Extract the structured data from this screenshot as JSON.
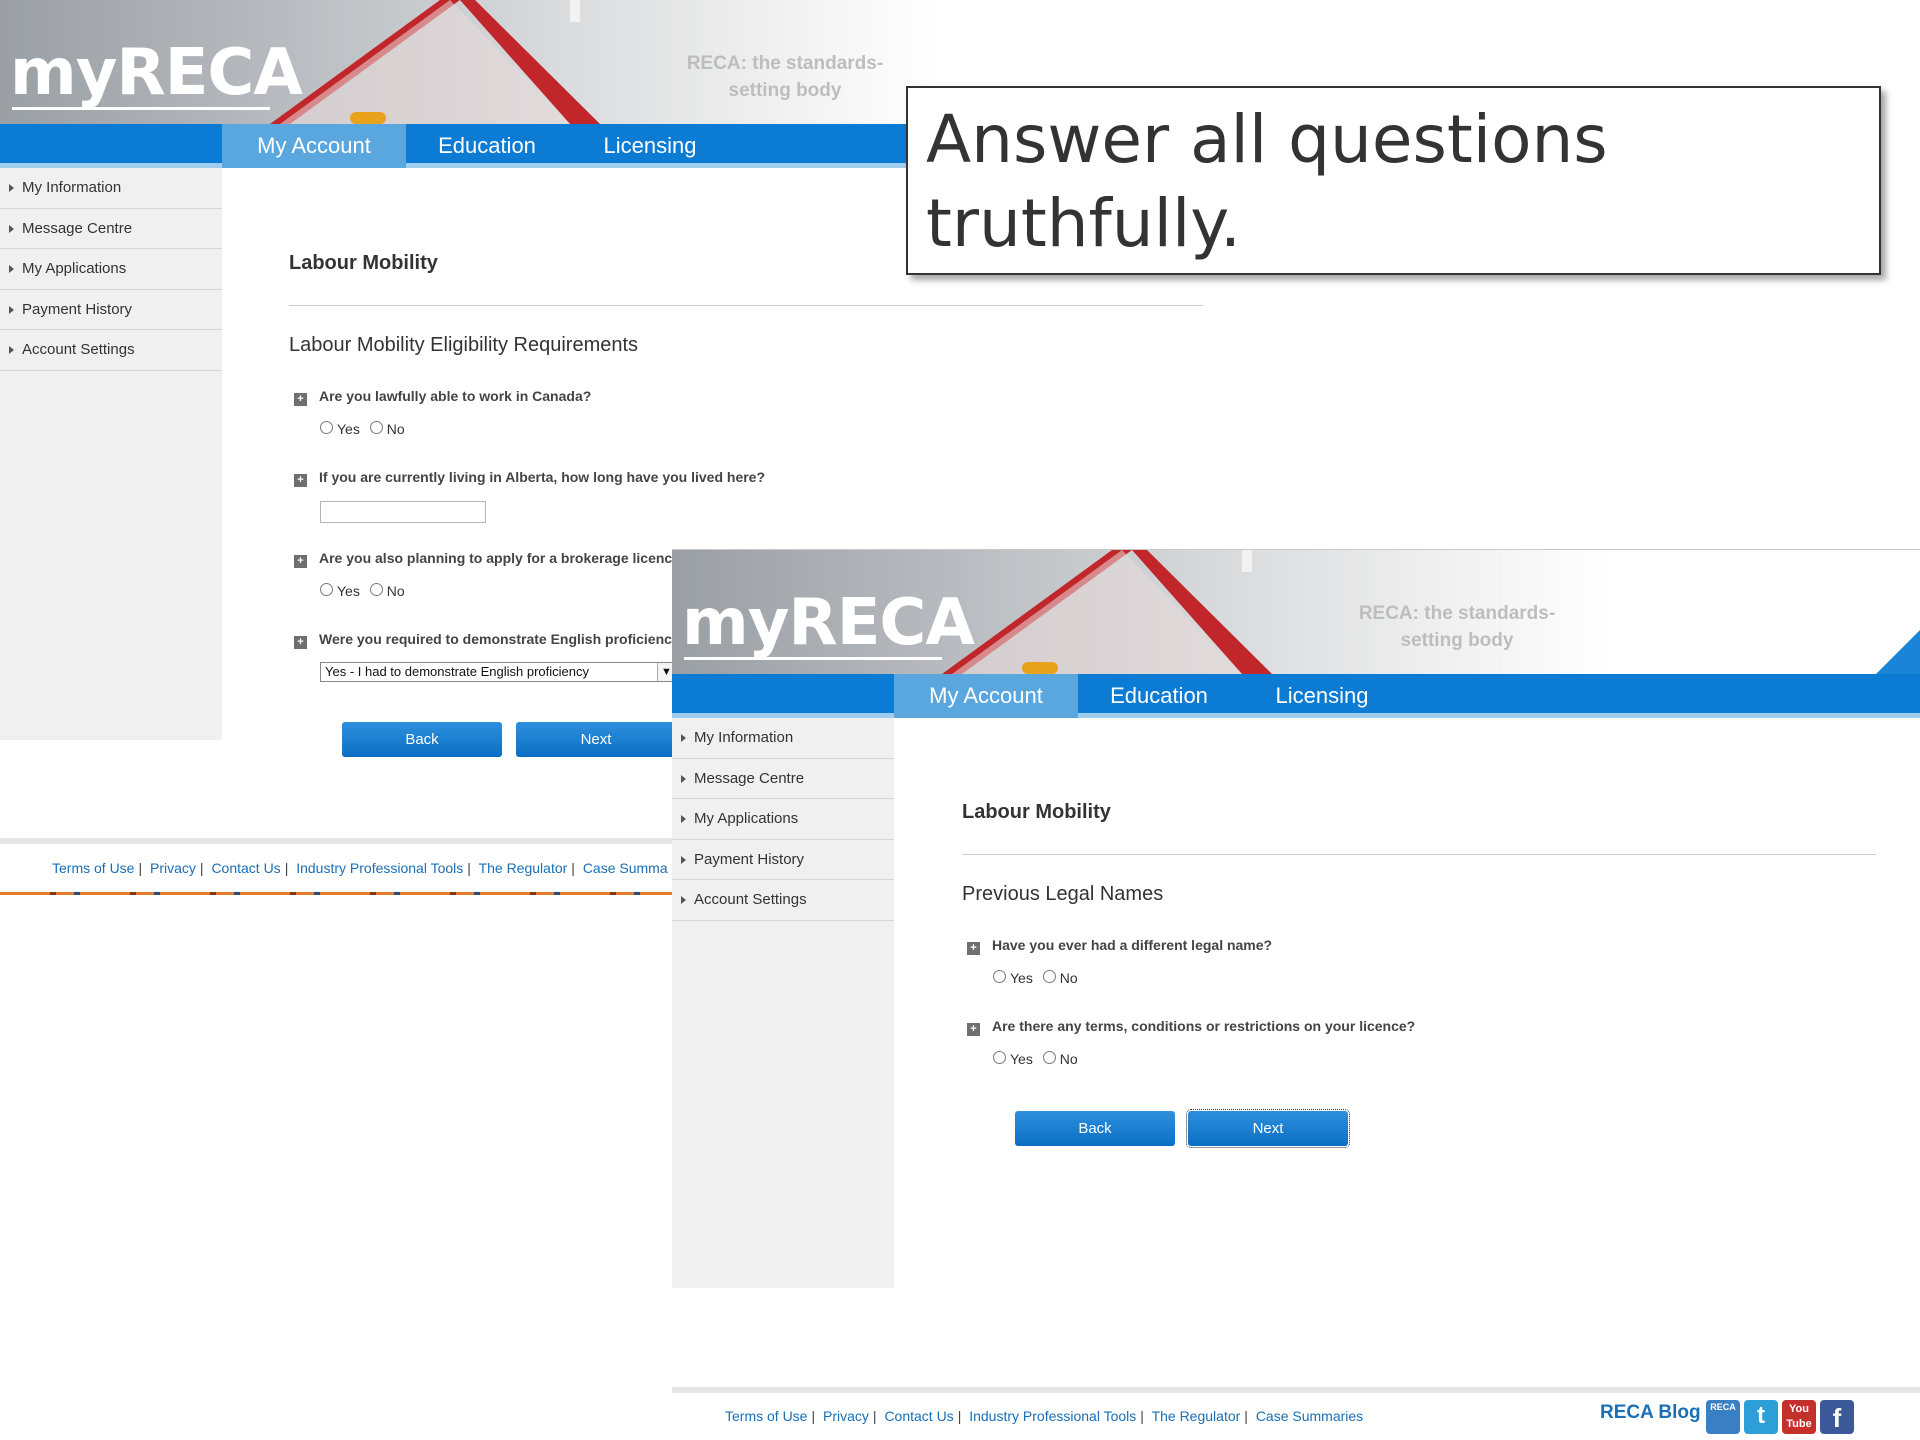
{
  "brand": {
    "logo": "myRECA",
    "tagline": "RECA: the standards-setting body"
  },
  "nav": {
    "tabs": [
      {
        "label": "My Account",
        "active": true
      },
      {
        "label": "Education",
        "active": false
      },
      {
        "label": "Licensing",
        "active": false
      }
    ]
  },
  "sidebar": {
    "items": [
      {
        "label": "My Information"
      },
      {
        "label": "Message Centre"
      },
      {
        "label": "My Applications"
      },
      {
        "label": "Payment History"
      },
      {
        "label": "Account Settings"
      }
    ]
  },
  "screen1": {
    "page_title": "Labour Mobility",
    "section_title": "Labour Mobility Eligibility Requirements",
    "questions": [
      {
        "text": "Are you lawfully able to work in Canada?",
        "yes": "Yes",
        "no": "No"
      },
      {
        "text": "If you are currently living in Alberta, how long have you lived here?",
        "value": ""
      },
      {
        "text": "Are you also planning to apply for a brokerage licence",
        "yes": "Yes",
        "no": "No"
      },
      {
        "text": "Were you required to demonstrate English proficiency",
        "selected": "Yes - I had to demonstrate English proficiency"
      }
    ],
    "back_label": "Back",
    "next_label": "Next"
  },
  "screen2": {
    "page_title": "Labour Mobility",
    "section_title": "Previous Legal Names",
    "questions": [
      {
        "text": "Have you ever had a different legal name?",
        "yes": "Yes",
        "no": "No"
      },
      {
        "text": "Are there any terms, conditions or restrictions on your licence?",
        "yes": "Yes",
        "no": "No"
      }
    ],
    "back_label": "Back",
    "next_label": "Next"
  },
  "footer": {
    "links": [
      "Terms of Use",
      "Privacy",
      "Contact Us",
      "Industry Professional Tools",
      "The Regulator",
      "Case Summaries"
    ],
    "links_truncated_last": "Case Summa",
    "separator": "|",
    "blog_label": "RECA Blog",
    "social": [
      {
        "icon": "reca-blog-icon",
        "text": "RECA",
        "color": "#3a7fc4"
      },
      {
        "icon": "twitter-icon",
        "text": "t",
        "color": "#2c9fd8"
      },
      {
        "icon": "youtube-icon",
        "text": "You Tube",
        "color": "#c4302b"
      },
      {
        "icon": "facebook-icon",
        "text": "f",
        "color": "#3b5998"
      }
    ]
  },
  "callout": {
    "text": "Answer all questions truthfully."
  },
  "colors": {
    "nav_blue": "#0b7bd3",
    "active_tab": "#5aa7e0",
    "link_blue": "#1a6fb5",
    "sidebar_bg": "#f0f0f0"
  }
}
